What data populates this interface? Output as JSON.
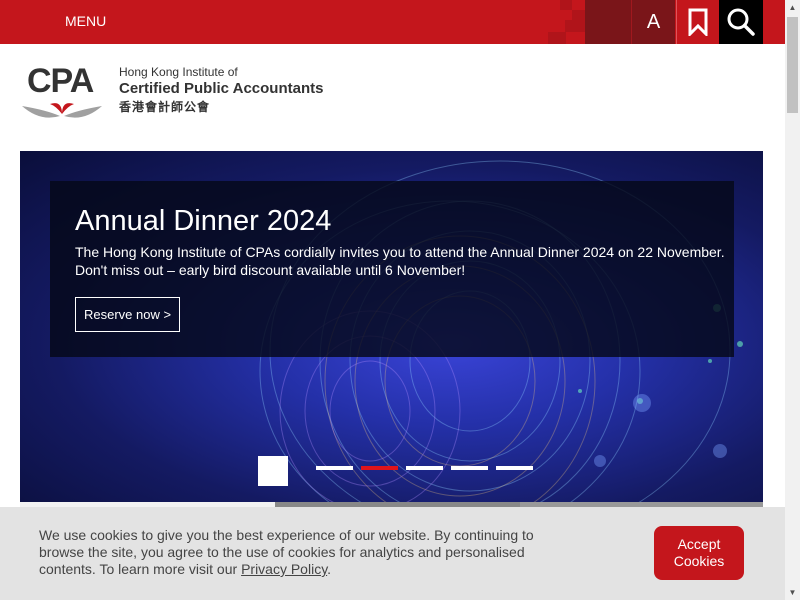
{
  "header": {
    "menu_label": "MENU",
    "font_size_label": "A",
    "bookmark_icon": "bookmark-icon",
    "search_icon": "search-icon"
  },
  "logo": {
    "mark_text": "CPA",
    "line1": "Hong Kong Institute of",
    "line2": "Certified Public Accountants",
    "line3": "香港會計師公會"
  },
  "hero": {
    "title": "Annual Dinner 2024",
    "description": "The Hong Kong Institute of CPAs cordially invites you to attend the Annual Dinner 2024 on 22 November. Don't miss out – early bird discount available until 6 November!",
    "button_label": "Reserve now >",
    "slide_count": 5,
    "active_slide": 2
  },
  "cookie": {
    "text": "We use cookies to give you the best experience of our website. By continuing to browse the site, you agree to the use of cookies for analytics and personalised contents. To learn more visit our ",
    "link_text": "Privacy Policy",
    "text_end": ".",
    "accept_label": "Accept Cookies"
  },
  "colors": {
    "brand_red": "#c4161c",
    "dark_maroon": "#7a1519",
    "cookie_bg": "#e3e3e3"
  }
}
